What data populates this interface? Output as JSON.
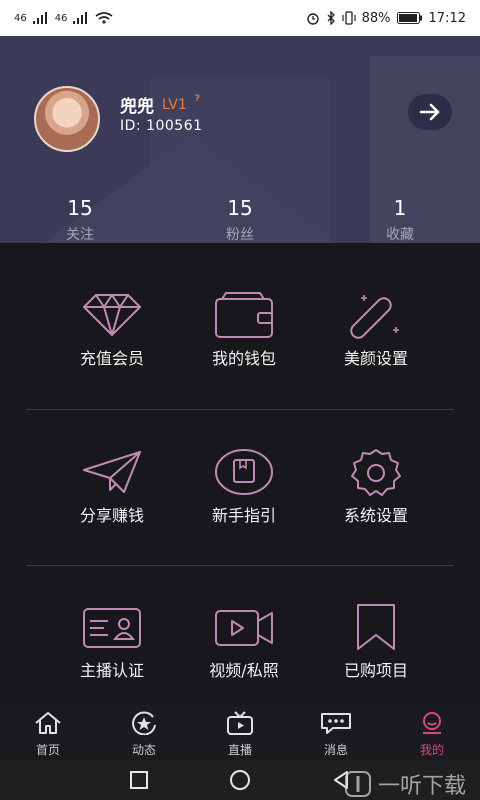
{
  "status_bar": {
    "signal1": "46",
    "signal2": "46",
    "battery": "88%",
    "time": "17:12"
  },
  "profile": {
    "name": "兜兜",
    "level": "LV1",
    "id_text": "ID: 100561"
  },
  "stats": [
    {
      "value": "15",
      "label": "关注"
    },
    {
      "value": "15",
      "label": "粉丝"
    },
    {
      "value": "1",
      "label": "收藏"
    }
  ],
  "menu": {
    "recharge": "充值会员",
    "wallet": "我的钱包",
    "beauty": "美颜设置",
    "share": "分享赚钱",
    "guide": "新手指引",
    "system": "系统设置",
    "anchor": "主播认证",
    "video": "视频/私照",
    "purchased": "已购项目"
  },
  "nav": {
    "home": "首页",
    "moments": "动态",
    "live": "直播",
    "messages": "消息",
    "mine": "我的"
  },
  "watermark": "一听下载",
  "colors": {
    "accent": "#d8457f",
    "icon_stroke": "#c08bb3",
    "header_bg": "#3b3a58",
    "level": "#e87b3f"
  }
}
